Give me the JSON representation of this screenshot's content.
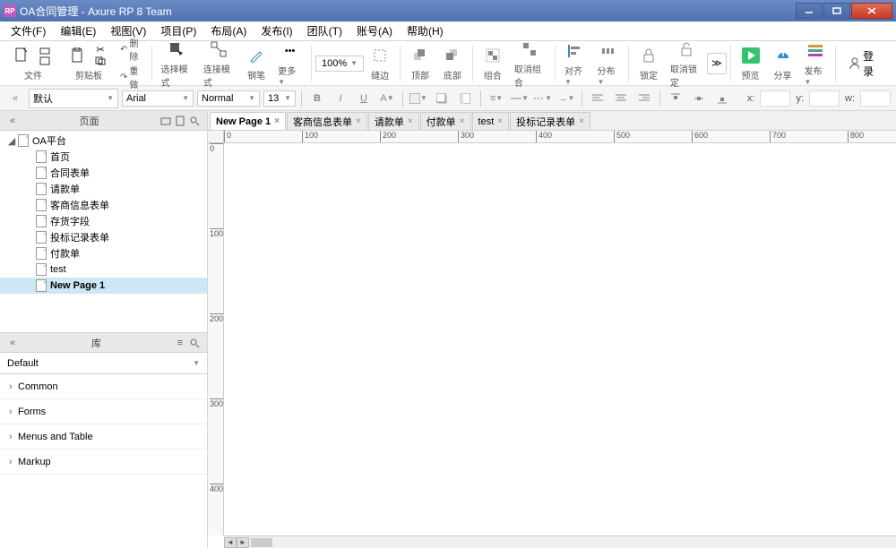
{
  "window": {
    "title": "OA合同管理 - Axure RP 8 Team",
    "logo_text": "RP"
  },
  "menu": [
    "文件(F)",
    "编辑(E)",
    "视图(V)",
    "项目(P)",
    "布局(A)",
    "发布(I)",
    "团队(T)",
    "账号(A)",
    "帮助(H)"
  ],
  "toolbar1": {
    "file": "文件",
    "clipboard": "剪贴板",
    "delete": "删除",
    "redo": "重做",
    "select_mode": "选择模式",
    "connect_mode": "连接模式",
    "pen": "钢笔",
    "more": "更多",
    "zoom": "100%",
    "edge": "缝边",
    "top": "顶部",
    "bottom": "底部",
    "group": "组合",
    "ungroup": "取消组合",
    "align": "对齐",
    "distribute": "分布",
    "lock": "锁定",
    "unlock": "取消锁定",
    "preview": "预览",
    "share": "分享",
    "publish": "发布",
    "login": "登录"
  },
  "toolbar2": {
    "default": "默认",
    "font": "Arial",
    "normal": "Normal",
    "size": "13",
    "x": "x:",
    "y": "y:",
    "w": "w:"
  },
  "pages_panel": {
    "label": "页面",
    "root": "OA平台",
    "items": [
      "首页",
      "合同表单",
      "请款单",
      "客商信息表单",
      "存货字段",
      "投标记录表单",
      "付款单",
      "test",
      "New Page 1"
    ],
    "selected_index": 8
  },
  "lib_panel": {
    "label": "库",
    "selector": "Default",
    "items": [
      "Common",
      "Forms",
      "Menus and Table",
      "Markup"
    ]
  },
  "tabs": {
    "items": [
      "New Page 1",
      "客商信息表单",
      "请款单",
      "付款单",
      "test",
      "投标记录表单"
    ],
    "active_index": 0
  },
  "ruler_h": [
    0,
    100,
    200,
    300,
    400,
    500,
    600,
    700,
    800
  ],
  "ruler_v": [
    0,
    100,
    200,
    300,
    400
  ]
}
